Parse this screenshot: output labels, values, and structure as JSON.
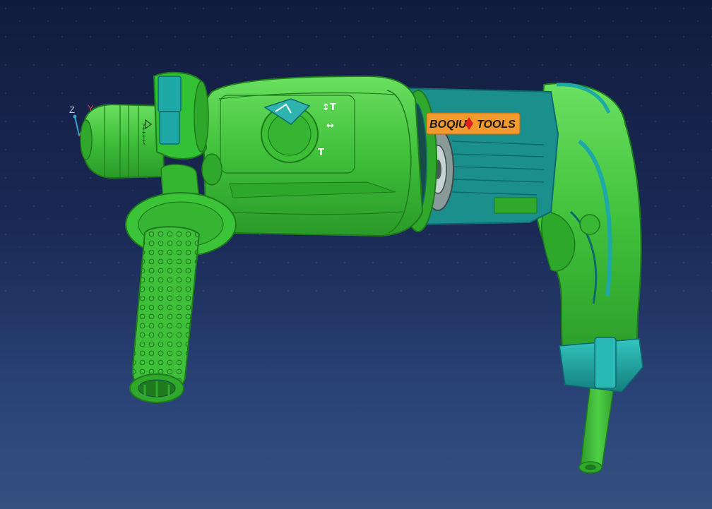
{
  "viewer": {
    "triad": {
      "z_label": "Z",
      "y_label": "Y",
      "z_color": "#c8d0e0",
      "y_color": "#e03a3a"
    }
  },
  "model": {
    "brand_label": {
      "left": "BOQIU",
      "right": "TOOLS",
      "separator_color": "#e0201f",
      "background": "#f29a2e"
    },
    "dial_marks": {
      "hammer_drill": "↕T",
      "chisel": "↔",
      "drill": "T"
    },
    "collar_text": ">++++<",
    "colors": {
      "body_green": "#3fbf3a",
      "edge_green": "#1e7a1c",
      "cutaway_teal": "#1fa9a6",
      "dark_teal": "#0e6a6e"
    }
  }
}
